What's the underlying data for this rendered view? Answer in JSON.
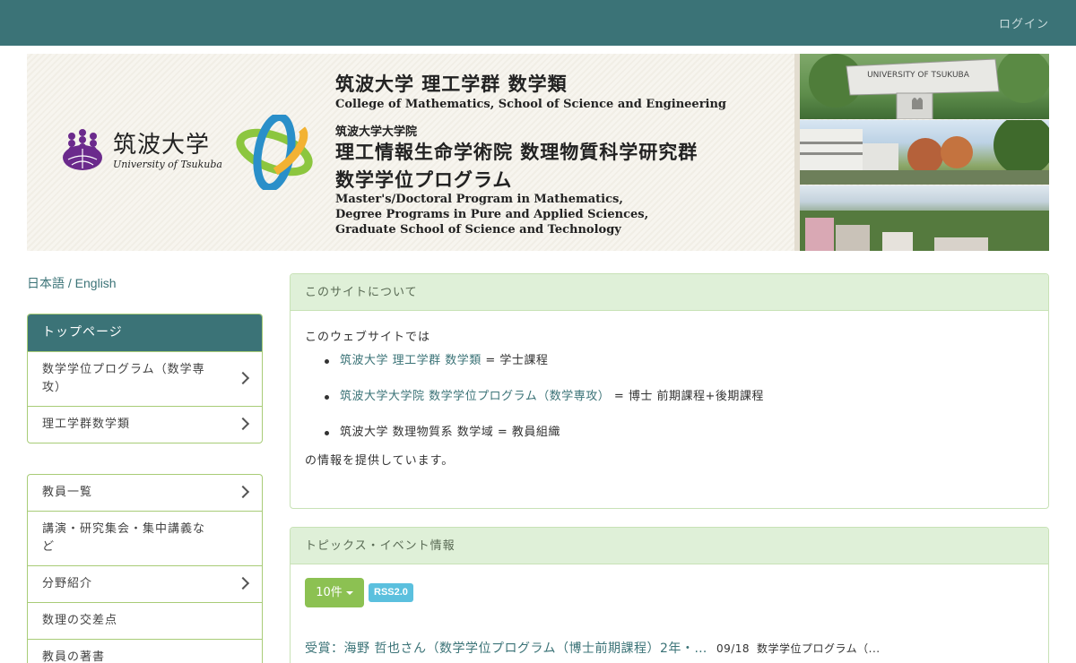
{
  "topbar": {
    "login_label": "ログイン"
  },
  "banner": {
    "university_jp": "筑波大学",
    "university_en": "University of Tsukuba",
    "line1": "筑波大学 理工学群 数学類",
    "line2": "College of Mathematics, School of Science and Engineering",
    "line3": "筑波大学大学院",
    "line4": "理工情報生命学術院 数理物質科学研究群",
    "line5": "数学学位プログラム",
    "line6a": "Master's/Doctoral Program in Mathematics,",
    "line6b": "Degree Programs in Pure and Applied Sciences,",
    "line6c": "Graduate School of Science and Technology",
    "photo_sign": "UNIVERSITY OF TSUKUBA"
  },
  "lang": {
    "ja": "日本語",
    "sep": " / ",
    "en": "English"
  },
  "sidebar": {
    "head": "トップページ",
    "items": [
      {
        "label": "数学学位プログラム（数学専攻）"
      },
      {
        "label": "理工学群数学類"
      }
    ],
    "items2": [
      {
        "label": "教員一覧"
      },
      {
        "label": "講演・研究集会・集中講義など"
      },
      {
        "label": "分野紹介"
      },
      {
        "label": "数理の交差点"
      },
      {
        "label": "教員の著書"
      }
    ]
  },
  "about": {
    "title": "このサイトについて",
    "intro": "このウェブサイトでは",
    "bullets": [
      {
        "link": "筑波大学 理工学群 数学類",
        "suffix": " = 学士課程"
      },
      {
        "link": "筑波大学大学院 数学学位プログラム（数学専攻）",
        "suffix": " = 博士 前期課程+後期課程"
      },
      {
        "text": "筑波大学 数理物質系 数学域",
        "suffix": " = 教員組織"
      }
    ],
    "outro": "の情報を提供しています。"
  },
  "topics": {
    "title": "トピックス・イベント情報",
    "count_label": "10件",
    "rss_label": "RSS2.0",
    "items": [
      {
        "title": "受賞：海野 哲也さん（数学学位プログラム（博士前期課程）2年・…",
        "date": "09/18",
        "category": "数学学位プログラム（..."
      }
    ]
  },
  "colors": {
    "topbar": "#3b7377",
    "accent_green": "#8cc152",
    "border_green": "#a8cc77",
    "panel_head": "#dff0d8",
    "rss": "#5bc0de"
  }
}
